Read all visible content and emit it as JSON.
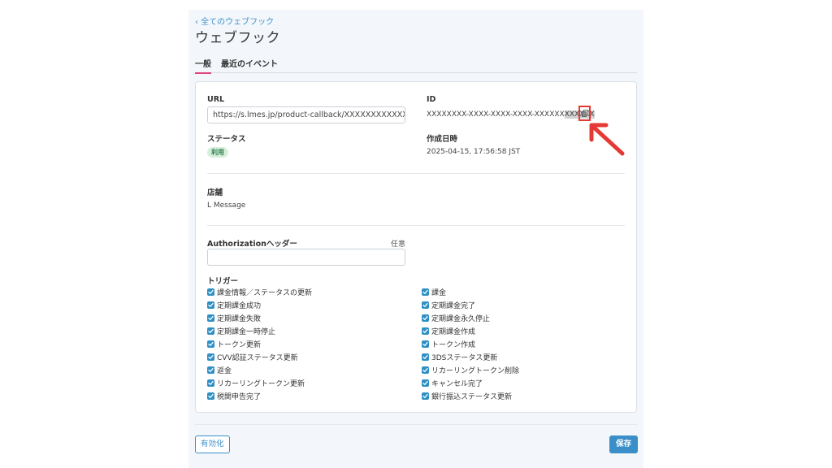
{
  "header": {
    "back_link": "‹ 全てのウェブフック",
    "title": "ウェブフック"
  },
  "tabs": [
    {
      "label": "一般",
      "active": true
    },
    {
      "label": "最近のイベント",
      "active": false
    }
  ],
  "details": {
    "url_label": "URL",
    "url_value": "https://s.lmes.jp/product-callback/XXXXXXXXXXXX",
    "id_label": "ID",
    "id_value": "XXXXXXXX-XXXX-XXXX-XXXX-XXXXXX",
    "id_value_highlight": "XXXXXX",
    "status_label": "ステータス",
    "status_value": "利用",
    "created_label": "作成日時",
    "created_value": "2025-04-15, 17:56:58 JST",
    "store_label": "店舗",
    "store_value": "L Message"
  },
  "authorization": {
    "label": "Authorizationヘッダー",
    "optional_label": "任意",
    "value": ""
  },
  "triggers": {
    "label": "トリガー",
    "left": [
      "課金情報／ステータスの更新",
      "定期課金成功",
      "定期課金失敗",
      "定期課金一時停止",
      "トークン更新",
      "CVV認証ステータス更新",
      "返金",
      "リカーリングトークン更新",
      "税関申告完了"
    ],
    "right": [
      "課金",
      "定期課金完了",
      "定期課金永久停止",
      "定期課金作成",
      "トークン作成",
      "3DSステータス更新",
      "リカーリングトークン削除",
      "キャンセル完了",
      "銀行振込ステータス更新"
    ]
  },
  "footer": {
    "activate_label": "有効化",
    "save_label": "保存"
  },
  "colors": {
    "accent": "#3a8fc8",
    "tab_active": "#e0447a",
    "annotation": "#e53935",
    "status_badge_bg": "#d6f0dc"
  }
}
